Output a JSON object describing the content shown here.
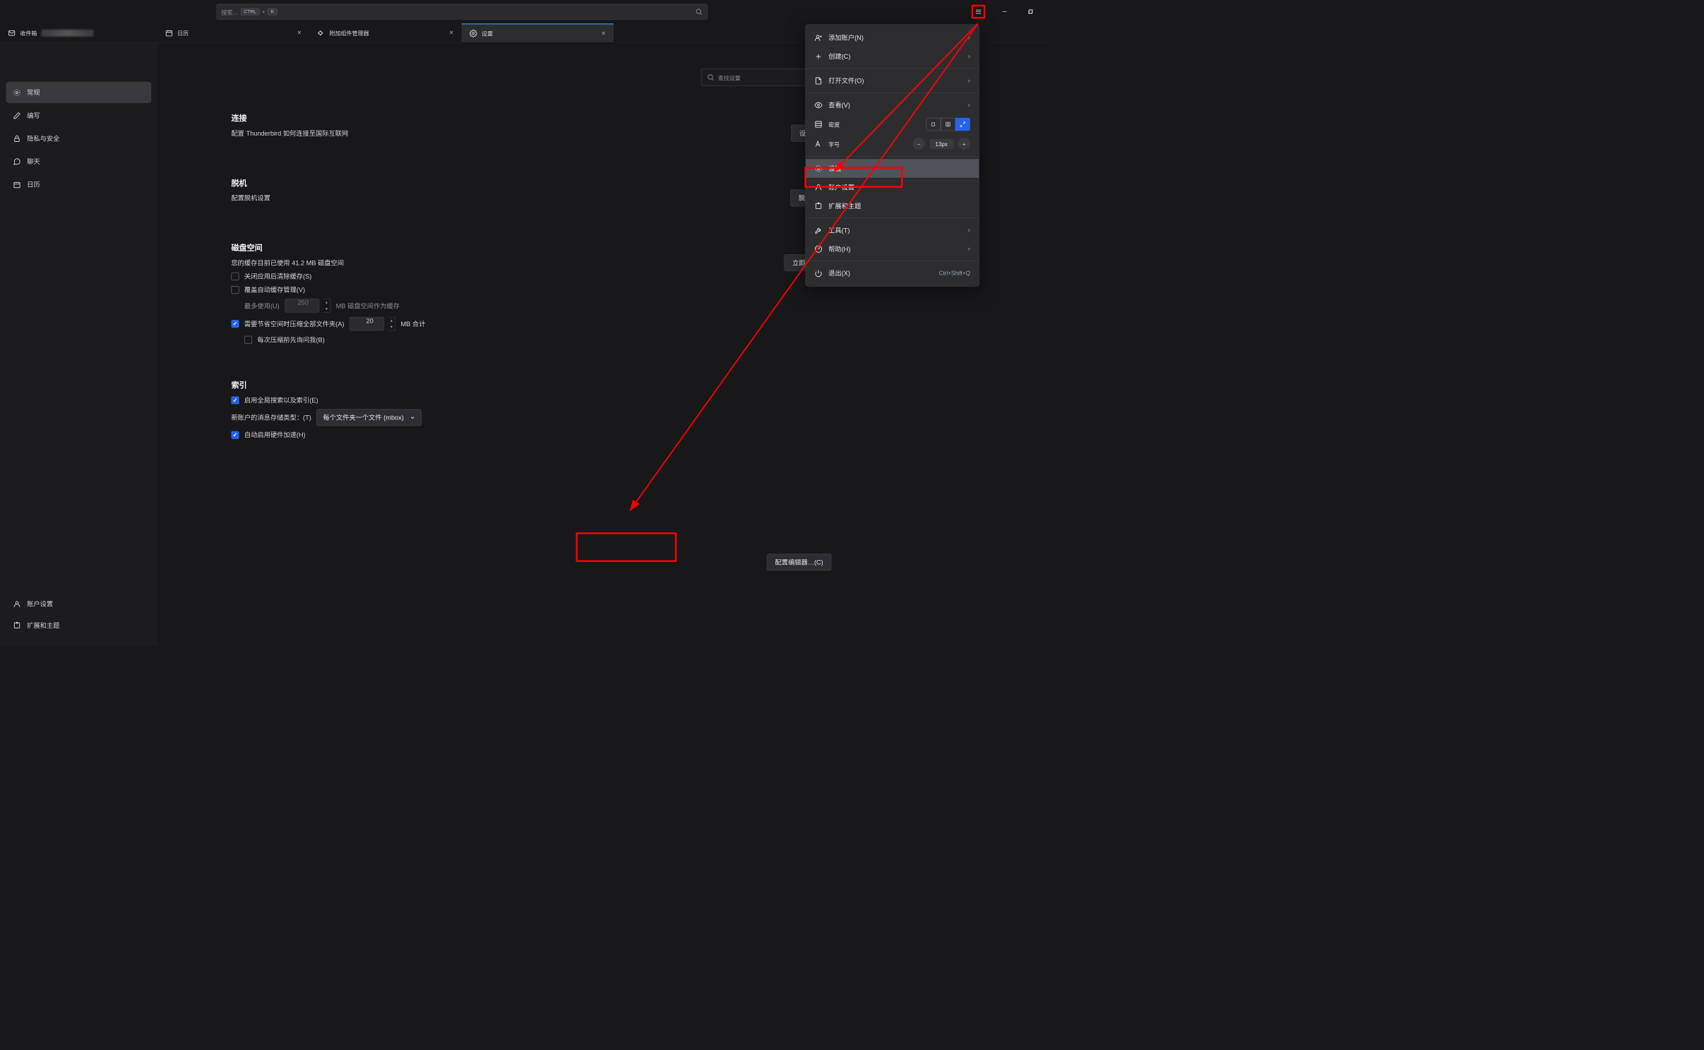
{
  "titlebar": {
    "search_placeholder": "搜索…",
    "kbd1": "CTRL",
    "kbd_plus": "+",
    "kbd2": "K"
  },
  "tabs": {
    "inbox": "收件箱",
    "calendar": "日历",
    "addons": "附加组件管理器",
    "settings": "设置"
  },
  "sidebar": {
    "general": "常规",
    "compose": "编写",
    "privacy": "隐私与安全",
    "chat": "聊天",
    "calendar": "日历",
    "account_settings": "账户设置",
    "extensions": "扩展和主题"
  },
  "content": {
    "find_placeholder": "查找设置",
    "connection": {
      "title": "连接",
      "desc": "配置 Thunderbird 如何连接至国际互联网",
      "btn": "设置…(S)"
    },
    "offline": {
      "title": "脱机",
      "desc": "配置脱机设置",
      "btn": "脱机…(O)"
    },
    "disk": {
      "title": "磁盘空间",
      "cache_desc_pre": "您的缓存目前已使用 ",
      "cache_size": "41.2 MB",
      "cache_desc_post": " 磁盘空间",
      "clear_btn": "立即清理(C)",
      "clear_on_close": "关闭应用后清除缓存(S)",
      "override_auto": "覆盖自动缓存管理(V)",
      "max_use_label": "最多使用(U)",
      "max_use_value": "250",
      "max_use_unit": "MB 磁盘空间作为缓存",
      "compact_label": "需要节省空间时压缩全部文件夹(A)",
      "compact_value": "20",
      "compact_unit": "MB 合计",
      "ask_before": "每次压缩前先询问我(B)"
    },
    "index": {
      "title": "索引",
      "global_search": "启用全局搜索以及索引(E)",
      "store_label": "新账户的消息存储类型：(T)",
      "store_value": "每个文件夹一个文件 (mbox)",
      "hw_accel": "自动启用硬件加速(H)"
    },
    "config_editor": "配置编辑器…(C)"
  },
  "menu": {
    "add_account": "添加账户(N)",
    "create": "创建(C)",
    "open_file": "打开文件(O)",
    "view": "查看(V)",
    "density": "密度",
    "font_size": "字号",
    "font_value": "13px",
    "settings": "设置",
    "account_settings": "账户设置",
    "extensions": "扩展和主题",
    "tools": "工具(T)",
    "help": "帮助(H)",
    "quit": "退出(X)",
    "quit_shortcut": "Ctrl+Shift+Q"
  }
}
